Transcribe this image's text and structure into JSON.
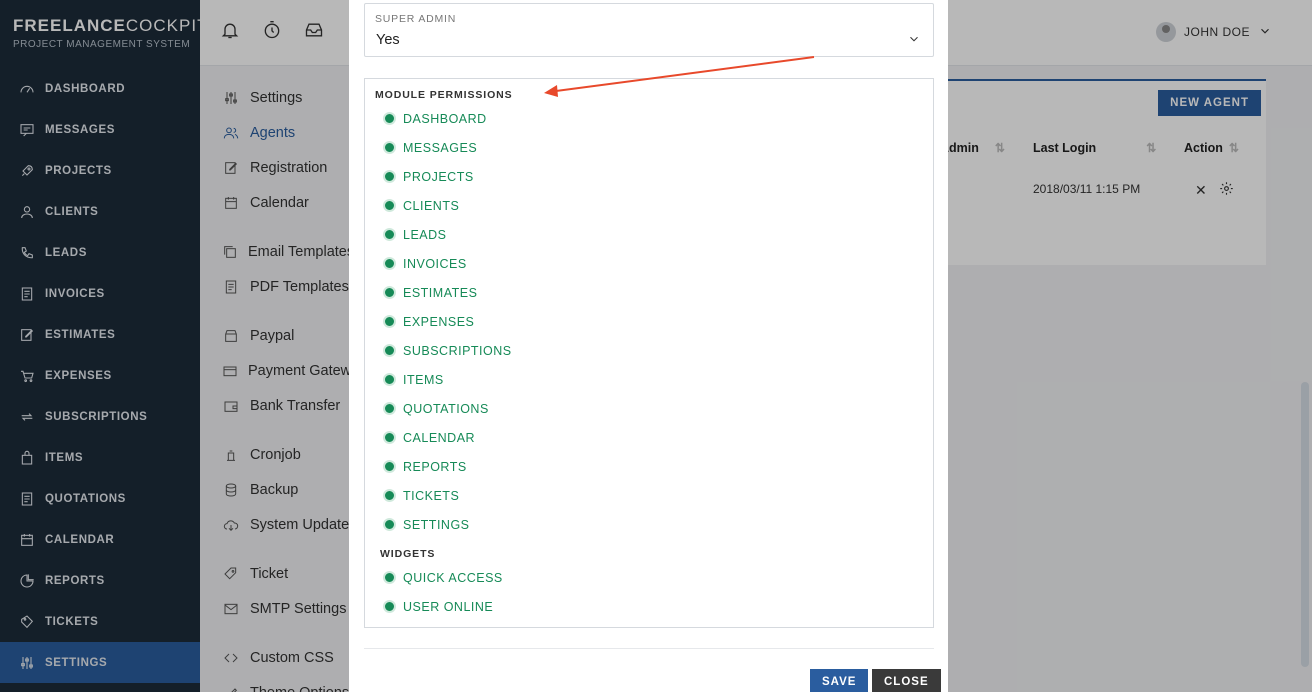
{
  "brand": {
    "name_bold": "FREELANCE",
    "name_light": "COCKPIT",
    "subtitle": "PROJECT MANAGEMENT SYSTEM"
  },
  "sidebar": {
    "items": [
      {
        "label": "DASHBOARD",
        "icon": "gauge-icon"
      },
      {
        "label": "MESSAGES",
        "icon": "message-icon"
      },
      {
        "label": "PROJECTS",
        "icon": "rocket-icon"
      },
      {
        "label": "CLIENTS",
        "icon": "user-icon"
      },
      {
        "label": "LEADS",
        "icon": "phone-icon"
      },
      {
        "label": "INVOICES",
        "icon": "document-icon"
      },
      {
        "label": "ESTIMATES",
        "icon": "edit-icon"
      },
      {
        "label": "EXPENSES",
        "icon": "cart-icon"
      },
      {
        "label": "SUBSCRIPTIONS",
        "icon": "repeat-icon"
      },
      {
        "label": "ITEMS",
        "icon": "bag-icon"
      },
      {
        "label": "QUOTATIONS",
        "icon": "document-icon"
      },
      {
        "label": "CALENDAR",
        "icon": "calendar-icon"
      },
      {
        "label": "REPORTS",
        "icon": "chart-icon"
      },
      {
        "label": "TICKETS",
        "icon": "ticket-icon"
      },
      {
        "label": "SETTINGS",
        "icon": "sliders-icon",
        "active": true
      }
    ]
  },
  "topbar": {
    "user_name": "JOHN DOE"
  },
  "settings_menu": {
    "groups": [
      [
        "Settings",
        "Agents",
        "Registration",
        "Calendar"
      ],
      [
        "Email Templates",
        "PDF Templates"
      ],
      [
        "Paypal",
        "Payment Gateway",
        "Bank Transfer"
      ],
      [
        "Cronjob",
        "Backup",
        "System Update"
      ],
      [
        "Ticket",
        "SMTP Settings"
      ],
      [
        "Custom CSS",
        "Theme Options"
      ]
    ],
    "active": "Agents"
  },
  "agents_panel": {
    "new_agent_label": "NEW AGENT",
    "columns": {
      "admin": "Admin",
      "last_login": "Last Login",
      "action": "Action"
    },
    "row": {
      "last_login": "2018/03/11 1:15 PM"
    }
  },
  "modal": {
    "super_admin": {
      "label": "SUPER ADMIN",
      "value": "Yes"
    },
    "module_permissions_title": "MODULE PERMISSIONS",
    "modules": [
      "DASHBOARD",
      "MESSAGES",
      "PROJECTS",
      "CLIENTS",
      "LEADS",
      "INVOICES",
      "ESTIMATES",
      "EXPENSES",
      "SUBSCRIPTIONS",
      "ITEMS",
      "QUOTATIONS",
      "CALENDAR",
      "REPORTS",
      "TICKETS",
      "SETTINGS"
    ],
    "widgets_title": "WIDGETS",
    "widgets": [
      "QUICK ACCESS",
      "USER ONLINE"
    ],
    "save_label": "SAVE",
    "close_label": "CLOSE"
  },
  "colors": {
    "sidebar_bg": "#1d2b3a",
    "accent": "#2a5d9f",
    "permission_green": "#168a57",
    "annotation_arrow": "#e8492b"
  }
}
